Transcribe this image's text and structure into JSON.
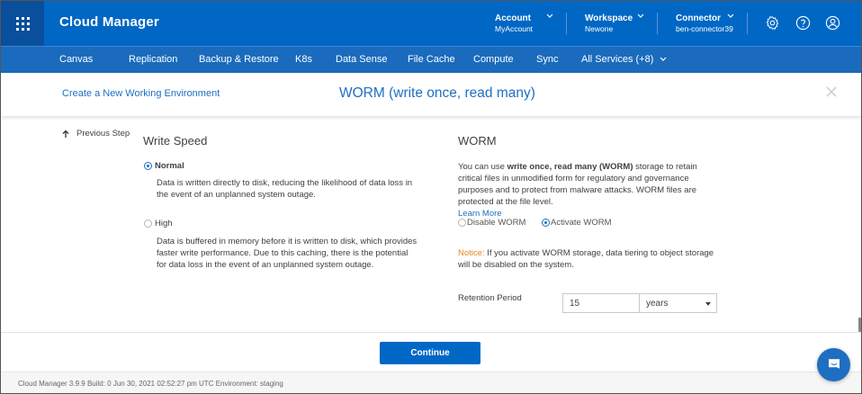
{
  "colors": {
    "header_bg": "#0067c5",
    "nav_bg": "#1a6bbd",
    "accent": "#1e6fc2",
    "notice": "#e0891c",
    "button": "#0067c5"
  },
  "header": {
    "title": "Cloud Manager",
    "apps_icon": "apps-grid-icon",
    "account": {
      "label": "Account",
      "value": "MyAccount"
    },
    "workspace": {
      "label": "Workspace",
      "value": "Newone"
    },
    "connector": {
      "label": "Connector",
      "value": "ben-connector39"
    },
    "icons": [
      "gear-icon",
      "help-icon",
      "user-icon"
    ]
  },
  "nav": {
    "items": [
      "Canvas",
      "Replication",
      "Backup & Restore",
      "K8s",
      "Data Sense",
      "File Cache",
      "Compute",
      "Sync",
      "All Services (+8)"
    ]
  },
  "wizard": {
    "link": "Create a New Working Environment",
    "title": "WORM (write once, read many)"
  },
  "prev_step": "Previous Step",
  "write_speed": {
    "title": "Write Speed",
    "options": [
      {
        "label": "Normal",
        "selected": true,
        "desc": [
          "Data is written directly to disk, reducing the likelihood of data loss in",
          "the event of an unplanned system outage."
        ]
      },
      {
        "label": "High",
        "selected": false,
        "desc": [
          "Data is buffered in memory before it is written to disk, which provides",
          "faster write performance. Due to this caching, there is the potential",
          "for data loss in the event of an unplanned system outage."
        ]
      }
    ]
  },
  "worm": {
    "title": "WORM",
    "desc_prefix": "You can use ",
    "desc_bold": "write once, read many (WORM)",
    "desc_rest": " storage to retain critical files in unmodified form for regulatory and governance purposes and to protect from malware attacks. WORM files are protected at the file level.",
    "learn_more": "Learn More",
    "options": [
      {
        "label": "Disable WORM",
        "selected": false
      },
      {
        "label": "Activate WORM",
        "selected": true
      }
    ],
    "notice_tag": "Notice:",
    "notice_text": " If you activate WORM storage, data tiering to object storage will be disabled on the system.",
    "retention": {
      "label": "Retention Period",
      "value": "15",
      "unit": "years"
    }
  },
  "footer": {
    "continue": "Continue",
    "status": "Cloud Manager 3.9.9   Build: 0   Jun 30, 2021 02:52:27 pm UTC   Environment: staging"
  }
}
